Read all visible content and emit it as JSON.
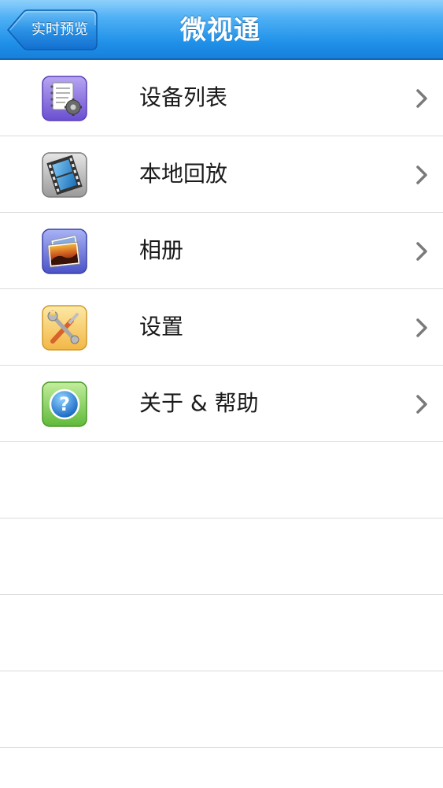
{
  "navbar": {
    "back_label": "实时预览",
    "title": "微视通"
  },
  "menu": [
    {
      "label": "设备列表",
      "icon": "device-list-icon"
    },
    {
      "label": "本地回放",
      "icon": "film-icon"
    },
    {
      "label": "相册",
      "icon": "photo-album-icon"
    },
    {
      "label": "设置",
      "icon": "tools-icon"
    },
    {
      "label": "关于 & 帮助",
      "icon": "help-icon"
    }
  ],
  "colors": {
    "navbar_top": "#8ed0fb",
    "navbar_bottom": "#1780db",
    "separator": "#dcdcdc",
    "chevron": "#7a7a7a"
  }
}
